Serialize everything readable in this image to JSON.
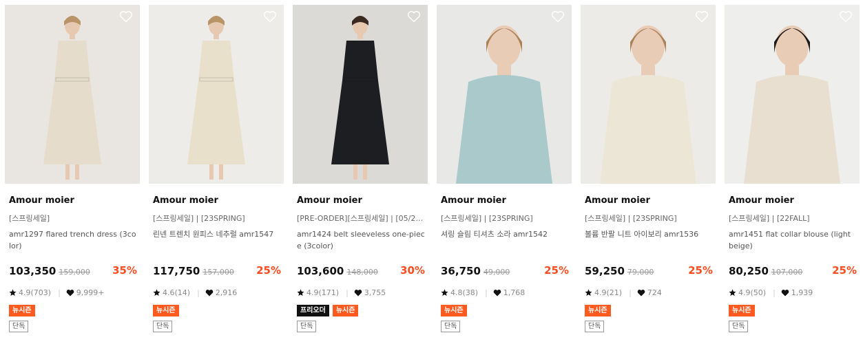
{
  "products": [
    {
      "brand": "Amour moier",
      "category": "[스프링세일]",
      "name": "amr1297 flared trench dress (3color)",
      "price": "103,350",
      "original_price": "159,000",
      "discount": "35%",
      "rating": "4.9(703)",
      "likes": "9,999+",
      "badges": [
        "뉴시즌"
      ],
      "exclusive": "단독",
      "bg": "#e9e6e1",
      "garment": "#e6dccb"
    },
    {
      "brand": "Amour moier",
      "category": "[스프링세일] | [23SPRING]",
      "name": "린넨 트렌치 원피스 네추럴 amr1547",
      "price": "117,750",
      "original_price": "157,000",
      "discount": "25%",
      "rating": "4.6(14)",
      "likes": "2,916",
      "badges": [
        "뉴시즌"
      ],
      "exclusive": "단독",
      "bg": "#eeece9",
      "garment": "#e9e0cc"
    },
    {
      "brand": "Amour moier",
      "category": "[PRE-ORDER][스프링세일] | [05/23...",
      "name": "amr1424 belt sleeveless one-piece (3color)",
      "price": "103,600",
      "original_price": "148,000",
      "discount": "30%",
      "rating": "4.9(171)",
      "likes": "3,755",
      "badges": [
        "프리오더",
        "뉴시즌"
      ],
      "exclusive": "단독",
      "bg": "#dcdad6",
      "garment": "#1d1e22"
    },
    {
      "brand": "Amour moier",
      "category": "[스프링세일] | [23SPRING]",
      "name": "셔링 슬림 티셔츠 소라 amr1542",
      "price": "36,750",
      "original_price": "49,000",
      "discount": "25%",
      "rating": "4.8(38)",
      "likes": "1,768",
      "badges": [
        "뉴시즌"
      ],
      "exclusive": "단독",
      "bg": "#e8e8e6",
      "garment": "#a9c9cb"
    },
    {
      "brand": "Amour moier",
      "category": "[스프링세일] | [23SPRING]",
      "name": "볼륨 반팔 니트 아이보리 amr1536",
      "price": "59,250",
      "original_price": "79,000",
      "discount": "25%",
      "rating": "4.9(21)",
      "likes": "724",
      "badges": [
        "뉴시즌"
      ],
      "exclusive": "단독",
      "bg": "#ecebe8",
      "garment": "#ece6d6"
    },
    {
      "brand": "Amour moier",
      "category": "[스프링세일] | [22FALL]",
      "name": "amr1451 flat collar blouse (light beige)",
      "price": "80,250",
      "original_price": "107,000",
      "discount": "25%",
      "rating": "4.9(50)",
      "likes": "1,939",
      "badges": [
        "뉴시즌"
      ],
      "exclusive": "단독",
      "bg": "#eeeeec",
      "garment": "#e8dfd1"
    }
  ],
  "colors": {
    "discount": "#ff4b1f",
    "badge_new": "#ff5a1f",
    "badge_pre": "#111111"
  },
  "icons": {
    "wishlist": "heart-outline-icon",
    "rating": "star-icon",
    "likes": "heart-filled-icon"
  }
}
